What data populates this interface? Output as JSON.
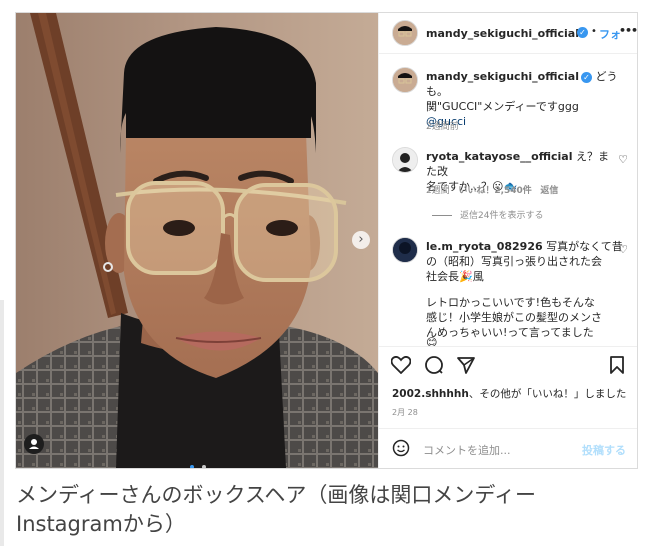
{
  "post": {
    "header_username": "mandy_sekiguchi_official",
    "follow_label": "フォ",
    "more_label": "•••",
    "caption_username": "mandy_sekiguchi_official",
    "caption_greeting": "どうも。",
    "caption_line2": "関\"GUCCI\"メンディーですggg",
    "caption_tag": "@gucci",
    "caption_time": "2週間前"
  },
  "comments": [
    {
      "username": "ryota_katayose__official",
      "text_line1": "え？また改",
      "text_line2": "名ですか…？😮🐟",
      "meta_time": "2週間",
      "meta_likes": "いいね！2,540件",
      "meta_reply": "返信"
    },
    {
      "username": "le.m_ryota_082926",
      "text_line1": "写真がなくて昔",
      "text_line2": "の（昭和）写真引っ張り出された会",
      "text_line3": "社会長🎉風"
    }
  ],
  "view_replies": "返信24件を表示する",
  "comment3": {
    "line1": "レトロかっこいいです!色もそんな",
    "line2": "感じ！小学生娘がこの髪型のメンさ",
    "line3": "んめっちゃいい!って言ってました",
    "line4": "😊"
  },
  "likes_line": {
    "user": "2002.shhhhh",
    "rest": "、その他が「いいね！」しました"
  },
  "date": "2月 28",
  "comment_input": {
    "placeholder": "コメントを追加...",
    "post_label": "投稿する"
  },
  "article_caption": "メンディーさんのボックスヘア（画像は関口メンディーInstagramから）",
  "colors": {
    "verified": "#3897f0",
    "post_button": "#b2dffc",
    "text": "#262626",
    "muted": "#8e8e8e"
  }
}
